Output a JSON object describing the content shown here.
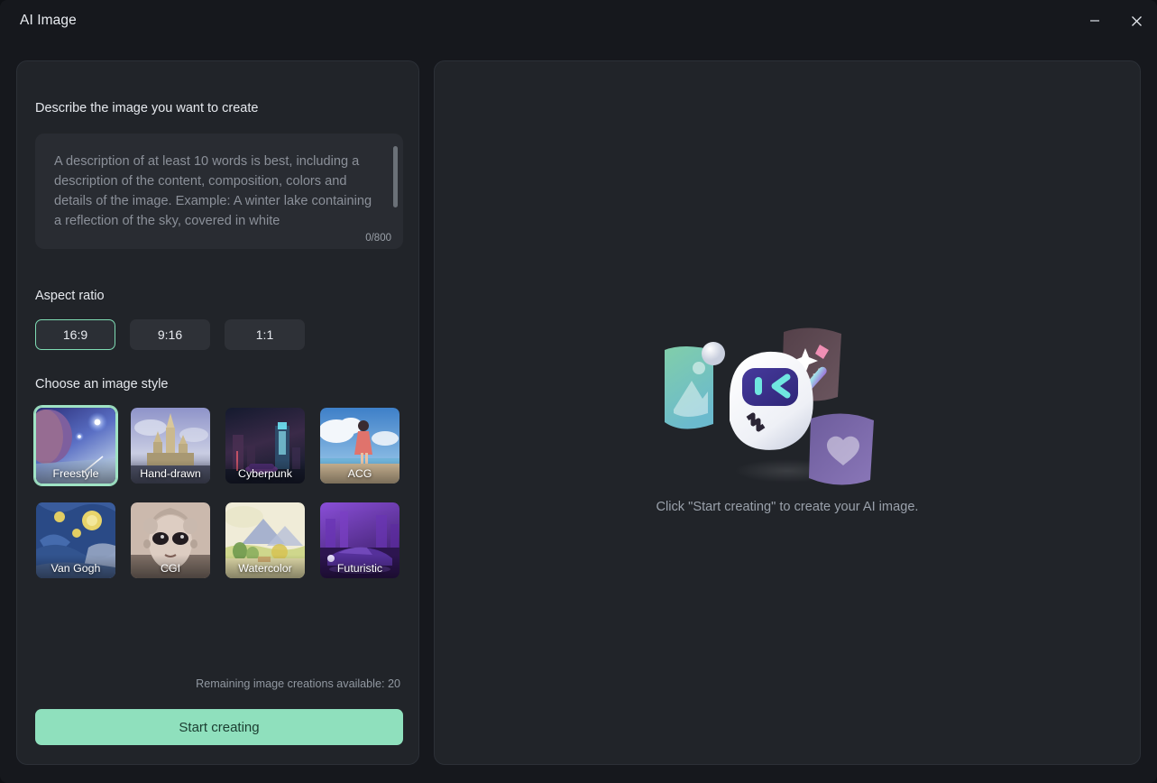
{
  "window": {
    "title": "AI Image",
    "minimize_icon": "minimize-icon",
    "close_icon": "close-icon"
  },
  "left_panel": {
    "prompt": {
      "label": "Describe the image you want to create",
      "placeholder": "A description of at least 10 words is best, including a description of the content, composition, colors and details of the image. Example: A winter lake containing a reflection of the sky, covered in white",
      "value": "",
      "counter": "0/800",
      "max_chars": 800
    },
    "aspect_ratio": {
      "label": "Aspect ratio",
      "selected": "16:9",
      "options": [
        "16:9",
        "9:16",
        "1:1"
      ]
    },
    "style": {
      "label": "Choose an image style",
      "selected": "Freestyle",
      "options": [
        {
          "name": "Freestyle",
          "thumb": "space-planet-thumb"
        },
        {
          "name": "Hand-drawn",
          "thumb": "castle-thumb"
        },
        {
          "name": "Cyberpunk",
          "thumb": "neon-city-thumb"
        },
        {
          "name": "ACG",
          "thumb": "beach-girl-thumb"
        },
        {
          "name": "Van Gogh",
          "thumb": "starry-night-thumb"
        },
        {
          "name": "CGI",
          "thumb": "android-face-thumb"
        },
        {
          "name": "Watercolor",
          "thumb": "watercolor-landscape-thumb"
        },
        {
          "name": "Futuristic",
          "thumb": "purple-car-thumb"
        }
      ]
    },
    "remaining_text": "Remaining image creations available: 20",
    "start_button": "Start creating"
  },
  "right_panel": {
    "empty_hint": "Click \"Start creating\" to create your AI image.",
    "illustration": "ai-robot-illustration"
  },
  "colors": {
    "accent": "#8fe0bd",
    "selection_border": "#7fdcb4",
    "panel_bg": "#212429",
    "window_bg": "#16181d",
    "input_bg": "#292c32",
    "chip_bg": "#2e3137",
    "text_primary": "#e9ecf1",
    "text_muted": "#9198a1"
  }
}
